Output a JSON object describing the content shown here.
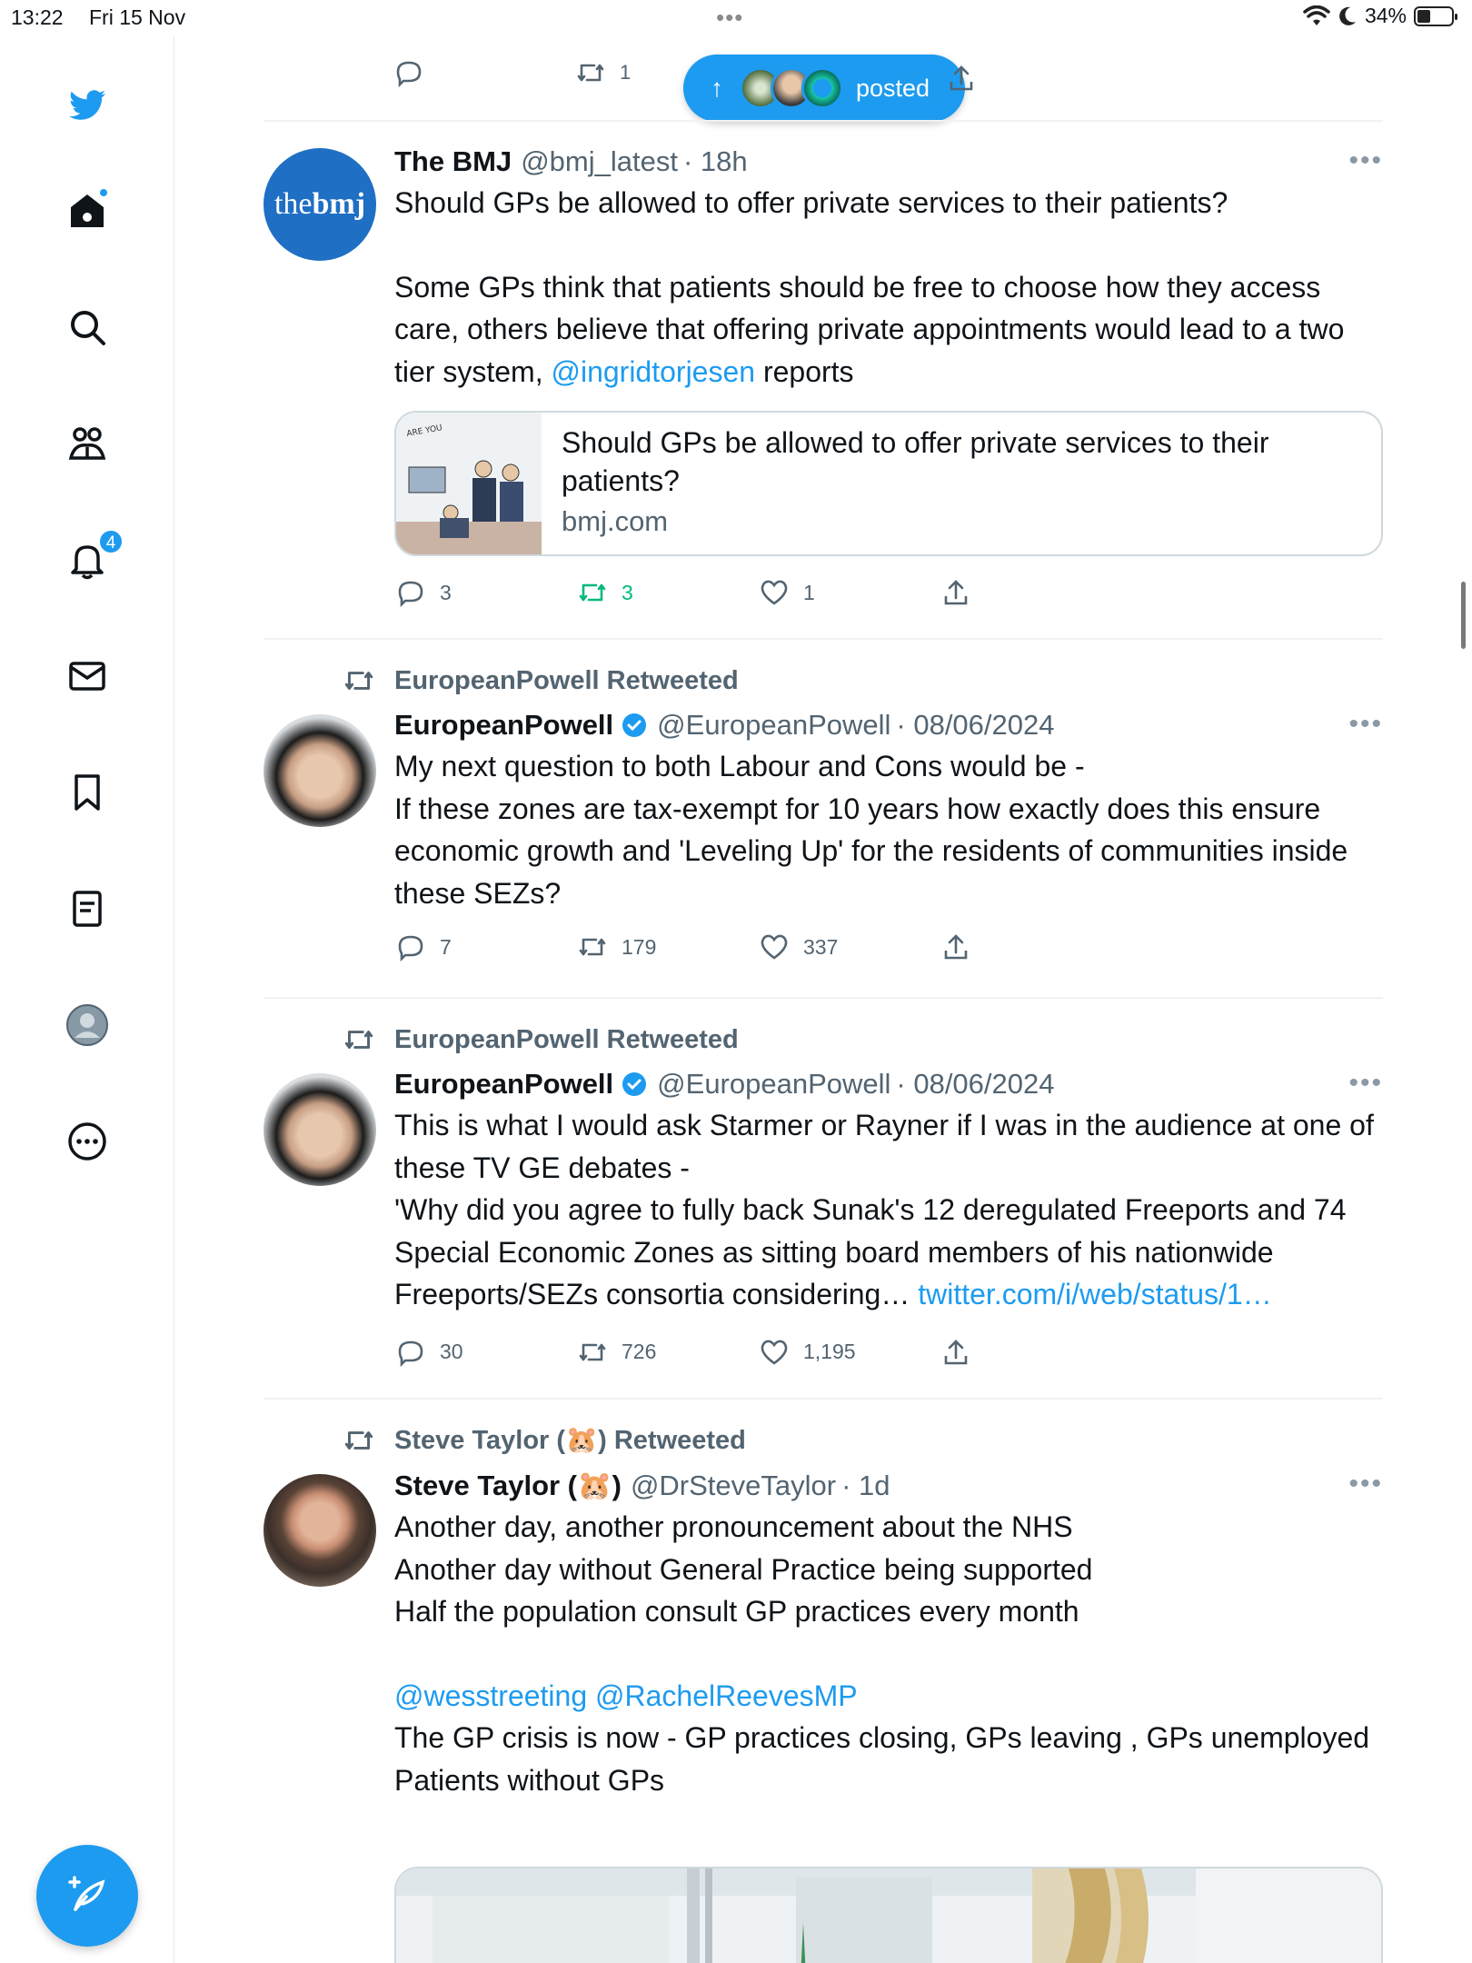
{
  "status_bar": {
    "time": "13:22",
    "date": "Fri 15 Nov",
    "dots": "•••",
    "battery": "34%",
    "battery_level": 0.34
  },
  "sidebar": {
    "items": [
      {
        "icon": "twitter-bird-icon"
      },
      {
        "icon": "home-icon"
      },
      {
        "icon": "search-icon"
      },
      {
        "icon": "communities-icon"
      },
      {
        "icon": "notifications-bell-icon",
        "badge": "4"
      },
      {
        "icon": "messages-envelope-icon"
      },
      {
        "icon": "bookmark-icon"
      },
      {
        "icon": "lists-icon"
      },
      {
        "icon": "profile-avatar-icon"
      },
      {
        "icon": "more-circle-icon"
      }
    ],
    "compose_icon": "compose-feather-icon"
  },
  "colors": {
    "accent": "#1d9bf0",
    "text": "#0f1419",
    "muted": "#536471",
    "retweet_green": "#00ba7c",
    "divider": "#eff3f4"
  },
  "new_posts_pill": {
    "arrow": "↑",
    "label": "posted"
  },
  "top_partial_actions": {
    "retweets": "1"
  },
  "tweets": [
    {
      "name": "The BMJ",
      "handle": "@bmj_latest",
      "time": "· 18h",
      "avatar_text_a": "the",
      "avatar_text_b": "bmj",
      "text_line1": "Should GPs be allowed to offer private services to their patients?",
      "text_para2": "Some GPs think that patients should be free to choose how they access care, others believe that offering private appointments would lead to a two tier system, ",
      "mention": "@ingridtorjesen",
      "text_end": " reports",
      "card": {
        "title": "Should GPs be allowed to offer private services to their patients?",
        "domain": "bmj.com"
      },
      "replies": "3",
      "retweets": "3",
      "likes": "1"
    },
    {
      "retweeted_by": "EuropeanPowell Retweeted",
      "name": "EuropeanPowell",
      "handle": "@EuropeanPowell",
      "time": "· 08/06/2024",
      "text_line1": "My next question to both Labour and Cons would be -",
      "text_line2": "If these zones are tax-exempt for 10 years how exactly does this ensure economic growth and 'Leveling Up' for the residents of communities inside these SEZs?",
      "replies": "7",
      "retweets": "179",
      "likes": "337"
    },
    {
      "retweeted_by": "EuropeanPowell Retweeted",
      "name": "EuropeanPowell",
      "handle": "@EuropeanPowell",
      "time": "· 08/06/2024",
      "text_line1": "This is what I would ask Starmer or Rayner if I was in the audience at one of these TV GE debates -",
      "text_line2": "'Why did you agree to fully back Sunak's 12 deregulated Freeports and 74 Special Economic Zones as sitting board members of his nationwide Freeports/SEZs consortia considering… ",
      "link": "twitter.com/i/web/status/1…",
      "replies": "30",
      "retweets": "726",
      "likes": "1,195"
    },
    {
      "retweeted_by": "Steve Taylor (🐹) Retweeted",
      "name": "Steve Taylor (🐹)",
      "handle": "@DrSteveTaylor",
      "time": "· 1d",
      "text_line1": "Another day, another pronouncement about the NHS",
      "text_line2": "Another day without General Practice being supported",
      "text_line3": "Half the population consult GP practices every month",
      "mentions": "@wesstreeting @RachelReevesMP",
      "text_line4": "The GP crisis is now - GP practices closing, GPs leaving , GPs unemployed",
      "text_line5": "Patients without GPs"
    }
  ]
}
